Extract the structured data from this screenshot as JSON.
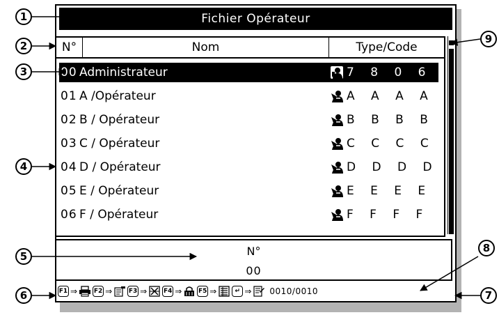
{
  "window": {
    "title": "Fichier Opérateur"
  },
  "table": {
    "headers": {
      "number": "N°",
      "name": "Nom",
      "type_code": "Type/Code"
    },
    "rows": [
      {
        "num": "00",
        "name": "Administrateur",
        "type": "admin-icon",
        "code": "7 8 0 6",
        "selected": true
      },
      {
        "num": "01",
        "name": "A /Opérateur",
        "type": "operator-icon",
        "code": "A A A A",
        "selected": false
      },
      {
        "num": "02",
        "name": "B / Opérateur",
        "type": "operator-icon",
        "code": "B B B B",
        "selected": false
      },
      {
        "num": "03",
        "name": "C / Opérateur",
        "type": "operator-icon",
        "code": "C C C C",
        "selected": false
      },
      {
        "num": "04",
        "name": "D / Opérateur",
        "type": "operator-icon",
        "code": "D D D D",
        "selected": false
      },
      {
        "num": "05",
        "name": "E / Opérateur",
        "type": "operator-icon",
        "code": "E E E E",
        "selected": false
      },
      {
        "num": "06",
        "name": "F / Opérateur",
        "type": "operator-icon",
        "code": "F F F F",
        "selected": false
      }
    ]
  },
  "number_field": {
    "label": "N°",
    "value": "00"
  },
  "function_keys": [
    {
      "key": "F1",
      "icon": "print-icon"
    },
    {
      "key": "F2",
      "icon": "edit-icon"
    },
    {
      "key": "F3",
      "icon": "delete-icon"
    },
    {
      "key": "F4",
      "icon": "lock-icon"
    },
    {
      "key": "F5",
      "icon": "list-icon"
    },
    {
      "key": "↵",
      "icon": "document-icon"
    }
  ],
  "counter": "0010/0010",
  "callouts": [
    "1",
    "2",
    "3",
    "4",
    "5",
    "6",
    "7",
    "8",
    "9"
  ]
}
